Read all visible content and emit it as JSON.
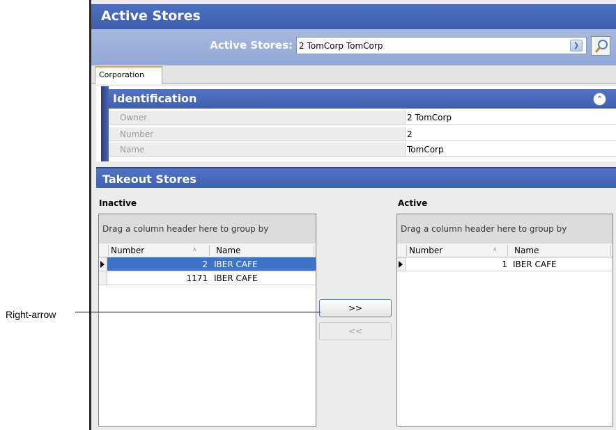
{
  "title": "Active Stores",
  "selector": {
    "label": "Active Stores:",
    "value": "2 TomCorp TomCorp"
  },
  "tabs": [
    {
      "label": "Corporation"
    }
  ],
  "identification": {
    "header": "Identification",
    "fields": [
      {
        "label": "Owner",
        "value": "2  TomCorp"
      },
      {
        "label": "Number",
        "value": "2"
      },
      {
        "label": "Name",
        "value": "TomCorp"
      }
    ]
  },
  "takeout": {
    "header": "Takeout Stores",
    "group_hint": "Drag a column header here to group by",
    "columns": {
      "number": "Number",
      "name": "Name"
    },
    "inactive": {
      "caption": "Inactive",
      "rows": [
        {
          "number": "2",
          "name": "IBER CAFE",
          "selected": true
        },
        {
          "number": "1171",
          "name": "IBER CAFE",
          "selected": false
        }
      ]
    },
    "active": {
      "caption": "Active",
      "rows": [
        {
          "number": "1",
          "name": "IBER CAFE",
          "selected": false
        }
      ]
    },
    "move_right_label": ">>",
    "move_left_label": "<<"
  },
  "callout": {
    "label": "Right-arrow"
  },
  "icons": {
    "search": "search-icon",
    "dropdown": "chevron-down-icon",
    "collapse": "collapse-up-icon",
    "row_indicator": "row-pointer-icon"
  },
  "colors": {
    "header_blue": "#3e5eae",
    "selection": "#3e73c7",
    "tab_accent": "#f2a23a"
  }
}
